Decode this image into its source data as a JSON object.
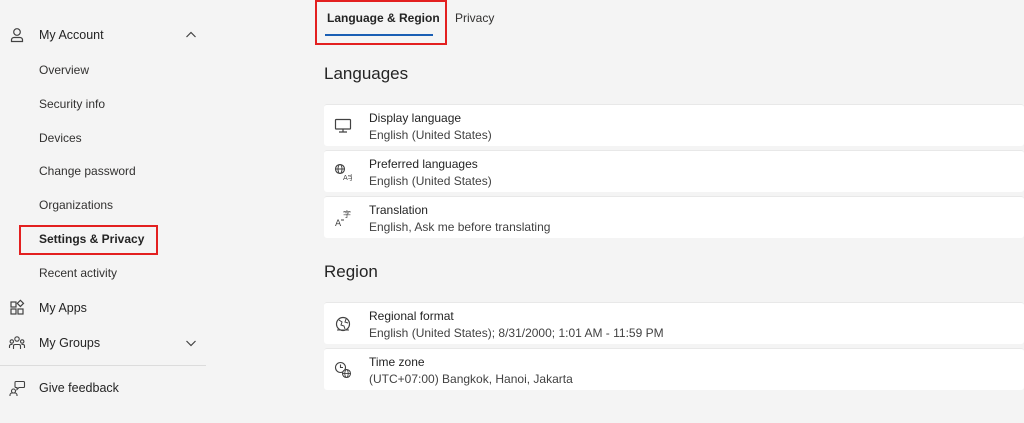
{
  "sidebar": {
    "my_account": {
      "label": "My Account",
      "icon": "person-icon",
      "expanded": true
    },
    "sub_items": [
      {
        "label": "Overview"
      },
      {
        "label": "Security info"
      },
      {
        "label": "Devices"
      },
      {
        "label": "Change password"
      },
      {
        "label": "Organizations"
      },
      {
        "label": "Settings & Privacy",
        "selected": true
      },
      {
        "label": "Recent activity"
      }
    ],
    "my_apps": {
      "label": "My Apps",
      "icon": "apps-icon"
    },
    "my_groups": {
      "label": "My Groups",
      "icon": "groups-icon",
      "expanded": false
    },
    "feedback": {
      "label": "Give feedback",
      "icon": "feedback-icon"
    }
  },
  "tabs": [
    {
      "label": "Language & Region",
      "active": true
    },
    {
      "label": "Privacy",
      "active": false
    }
  ],
  "languages": {
    "title": "Languages",
    "items": [
      {
        "title": "Display language",
        "value": "English (United States)",
        "icon": "monitor-icon"
      },
      {
        "title": "Preferred languages",
        "value": "English (United States)",
        "icon": "globe-language-icon"
      },
      {
        "title": "Translation",
        "value": "English, Ask me before translating",
        "icon": "translate-icon"
      }
    ]
  },
  "region": {
    "title": "Region",
    "items": [
      {
        "title": "Regional format",
        "value": "English (United States); 8/31/2000; 1:01 AM - 11:59 PM",
        "icon": "regional-format-icon"
      },
      {
        "title": "Time zone",
        "value": "(UTC+07:00) Bangkok, Hanoi, Jakarta",
        "icon": "time-zone-icon"
      }
    ]
  },
  "colors": {
    "accent": "#1a5fb4",
    "highlight": "#e32020",
    "background": "#f4f4f4",
    "card": "#ffffff"
  }
}
